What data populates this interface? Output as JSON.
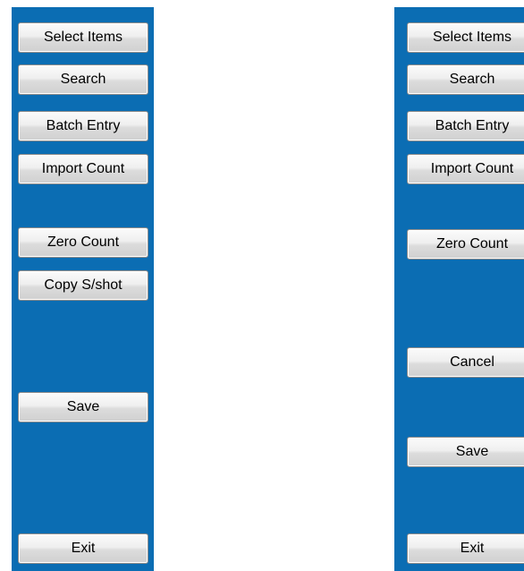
{
  "left_panel": {
    "buttons": {
      "select_items": "Select Items",
      "search": "Search",
      "batch_entry": "Batch Entry",
      "import_count": "Import Count",
      "zero_count": "Zero Count",
      "copy_snapshot": "Copy S/shot",
      "save": "Save",
      "exit": "Exit"
    }
  },
  "right_panel": {
    "buttons": {
      "select_items": "Select Items",
      "search": "Search",
      "batch_entry": "Batch Entry",
      "import_count": "Import Count",
      "zero_count": "Zero Count",
      "cancel": "Cancel",
      "save": "Save",
      "exit": "Exit"
    }
  },
  "colors": {
    "panel_background": "#0b6db3",
    "page_background": "#ffffff",
    "button_face": "#e8e8e8"
  }
}
